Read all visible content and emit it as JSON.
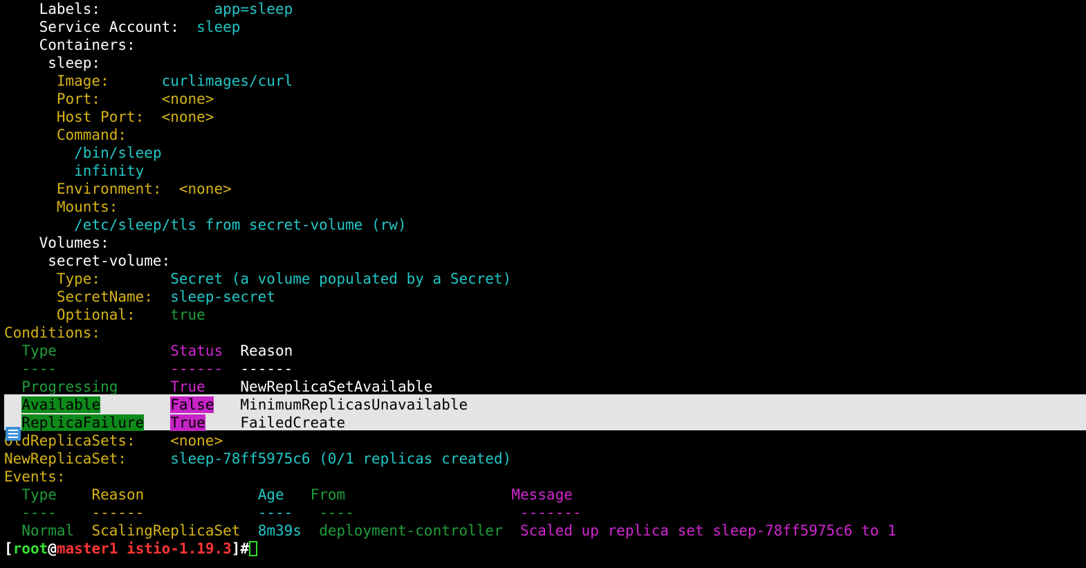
{
  "spec": {
    "labels_key": "Labels:",
    "labels_val": "app=sleep",
    "sa_key": "Service Account:",
    "sa_val": "sleep",
    "containers_key": "Containers:",
    "container_name": "sleep:",
    "image_key": "Image:",
    "image_val": "curlimages/curl",
    "port_key": "Port:",
    "port_val": "<none>",
    "hostport_key": "Host Port:",
    "hostport_val": "<none>",
    "command_key": "Command:",
    "command_lines": [
      "/bin/sleep",
      "infinity"
    ],
    "env_key": "Environment:",
    "env_val": "<none>",
    "mounts_key": "Mounts:",
    "mount_line": "/etc/sleep/tls from secret-volume (rw)",
    "volumes_key": "Volumes:",
    "volume_name": "secret-volume:",
    "vtype_key": "Type:",
    "vtype_val": "Secret (a volume populated by a Secret)",
    "secretname_key": "SecretName:",
    "secretname_val": "sleep-secret",
    "optional_key": "Optional:",
    "optional_val": "true"
  },
  "conditions": {
    "heading": "Conditions:",
    "headers": {
      "type": "Type",
      "status": "Status",
      "reason": "Reason"
    },
    "rules": {
      "type": "----",
      "status": "------",
      "reason": "------"
    },
    "rows": [
      {
        "type": "Progressing",
        "status": "True",
        "reason": "NewReplicaSetAvailable"
      },
      {
        "type": "Available",
        "status": "False",
        "reason": "MinimumReplicasUnavailable"
      },
      {
        "type": "ReplicaFailure",
        "status": "True",
        "reason": "FailedCreate"
      }
    ]
  },
  "replicasets": {
    "old_key": "OldReplicaSets:",
    "old_val": "<none>",
    "new_key": "NewReplicaSet:",
    "new_val": "sleep-78ff5975c6 (0/1 replicas created)"
  },
  "events": {
    "heading": "Events:",
    "headers": {
      "type": "Type",
      "reason": "Reason",
      "age": "Age",
      "from": "From",
      "message": "Message"
    },
    "rules": {
      "type": "----",
      "reason": "------",
      "age": "----",
      "from": "----",
      "message": "-------"
    },
    "rows": [
      {
        "type": "Normal",
        "reason": "ScalingReplicaSet",
        "age": "8m39s",
        "from": "deployment-controller",
        "message": "Scaled up replica set sleep-78ff5975c6 to 1"
      }
    ]
  },
  "prompt": {
    "open": "[",
    "user": "root",
    "at": "@",
    "host": "master1",
    "dir": "istio-1.19.3",
    "close": "]#"
  }
}
